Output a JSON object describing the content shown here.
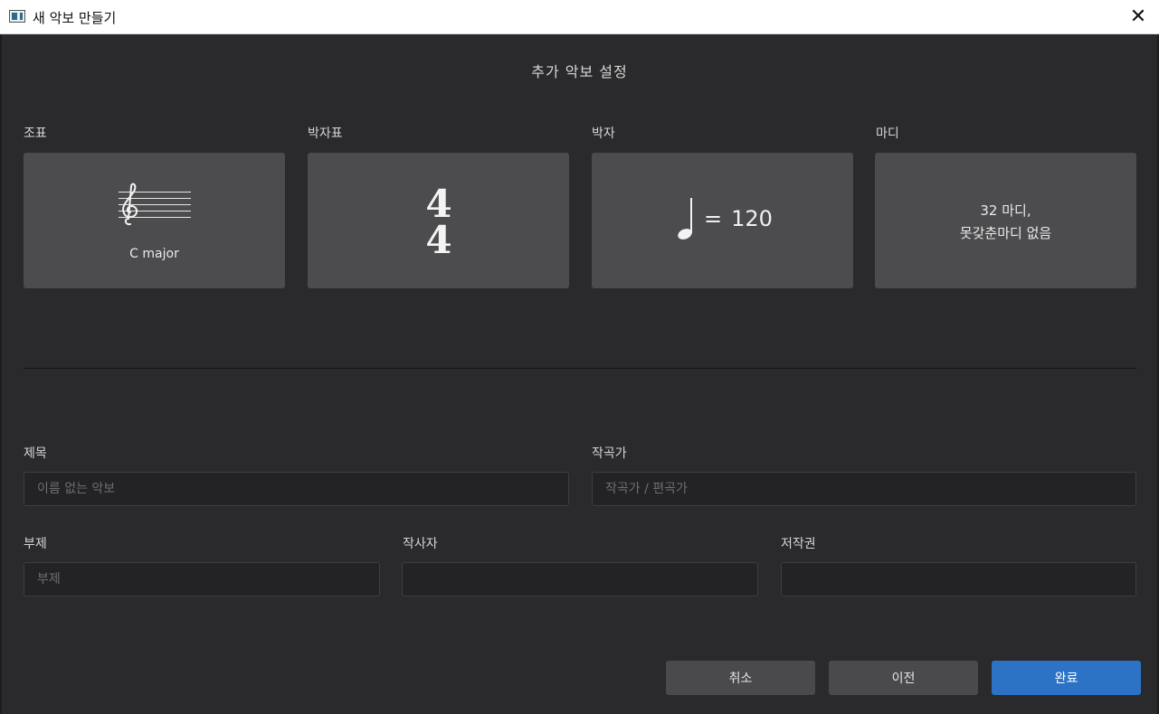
{
  "window": {
    "title": "새 악보 만들기",
    "close_glyph": "✕"
  },
  "page": {
    "title": "추가 악보 설정"
  },
  "cards": {
    "key": {
      "label": "조표",
      "value": "C major",
      "icon": "treble-clef-staff-icon"
    },
    "time_signature": {
      "label": "박자표",
      "numerator": "4",
      "denominator": "4"
    },
    "tempo": {
      "label": "박자",
      "equals": "=",
      "bpm": "120",
      "icon": "quarter-note-icon"
    },
    "measures": {
      "label": "마디",
      "line1": "32 마디,",
      "line2": "못갖춘마디 없음"
    }
  },
  "form": {
    "title": {
      "label": "제목",
      "placeholder": "이름 없는 악보",
      "value": ""
    },
    "composer": {
      "label": "작곡가",
      "placeholder": "작곡가 / 편곡가",
      "value": ""
    },
    "subtitle": {
      "label": "부제",
      "placeholder": "부제",
      "value": ""
    },
    "lyricist": {
      "label": "작사자",
      "placeholder": "",
      "value": ""
    },
    "copyright": {
      "label": "저작권",
      "placeholder": "",
      "value": ""
    }
  },
  "buttons": {
    "cancel": "취소",
    "back": "이전",
    "done": "완료"
  },
  "colors": {
    "background": "#2a2a2c",
    "card": "#4c4c4e",
    "input": "#232325",
    "primary": "#2c73c6",
    "secondary_button": "#4a4a4c"
  }
}
